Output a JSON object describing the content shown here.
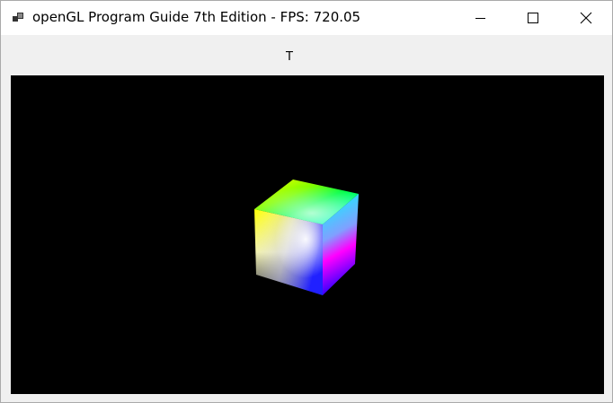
{
  "window": {
    "title": "openGL Program Guide 7th Edition - FPS: 720.05",
    "icons": {
      "app": "app-window-icon",
      "minimize": "minimize-icon",
      "maximize": "maximize-icon",
      "close": "close-icon"
    }
  },
  "toolbar": {
    "label": "T"
  },
  "viewport": {
    "background": "#000000",
    "scene": "rotating-color-cube"
  },
  "colors": {
    "titlebar": "#ffffff",
    "frame": "#f0f0f0",
    "cube_faces": [
      "#00ff00",
      "#ffff00",
      "#00ffff",
      "#ff00ff",
      "#0000ff",
      "#ffffff"
    ]
  }
}
